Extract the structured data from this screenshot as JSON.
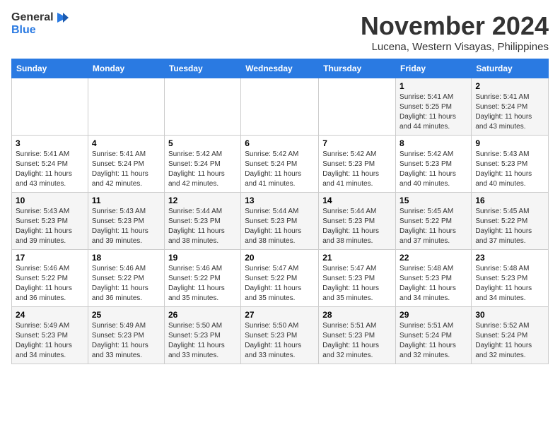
{
  "logo": {
    "line1": "General",
    "line2": "Blue"
  },
  "title": "November 2024",
  "location": "Lucena, Western Visayas, Philippines",
  "weekdays": [
    "Sunday",
    "Monday",
    "Tuesday",
    "Wednesday",
    "Thursday",
    "Friday",
    "Saturday"
  ],
  "weeks": [
    [
      {
        "day": "",
        "info": ""
      },
      {
        "day": "",
        "info": ""
      },
      {
        "day": "",
        "info": ""
      },
      {
        "day": "",
        "info": ""
      },
      {
        "day": "",
        "info": ""
      },
      {
        "day": "1",
        "info": "Sunrise: 5:41 AM\nSunset: 5:25 PM\nDaylight: 11 hours and 44 minutes."
      },
      {
        "day": "2",
        "info": "Sunrise: 5:41 AM\nSunset: 5:24 PM\nDaylight: 11 hours and 43 minutes."
      }
    ],
    [
      {
        "day": "3",
        "info": "Sunrise: 5:41 AM\nSunset: 5:24 PM\nDaylight: 11 hours and 43 minutes."
      },
      {
        "day": "4",
        "info": "Sunrise: 5:41 AM\nSunset: 5:24 PM\nDaylight: 11 hours and 42 minutes."
      },
      {
        "day": "5",
        "info": "Sunrise: 5:42 AM\nSunset: 5:24 PM\nDaylight: 11 hours and 42 minutes."
      },
      {
        "day": "6",
        "info": "Sunrise: 5:42 AM\nSunset: 5:24 PM\nDaylight: 11 hours and 41 minutes."
      },
      {
        "day": "7",
        "info": "Sunrise: 5:42 AM\nSunset: 5:23 PM\nDaylight: 11 hours and 41 minutes."
      },
      {
        "day": "8",
        "info": "Sunrise: 5:42 AM\nSunset: 5:23 PM\nDaylight: 11 hours and 40 minutes."
      },
      {
        "day": "9",
        "info": "Sunrise: 5:43 AM\nSunset: 5:23 PM\nDaylight: 11 hours and 40 minutes."
      }
    ],
    [
      {
        "day": "10",
        "info": "Sunrise: 5:43 AM\nSunset: 5:23 PM\nDaylight: 11 hours and 39 minutes."
      },
      {
        "day": "11",
        "info": "Sunrise: 5:43 AM\nSunset: 5:23 PM\nDaylight: 11 hours and 39 minutes."
      },
      {
        "day": "12",
        "info": "Sunrise: 5:44 AM\nSunset: 5:23 PM\nDaylight: 11 hours and 38 minutes."
      },
      {
        "day": "13",
        "info": "Sunrise: 5:44 AM\nSunset: 5:23 PM\nDaylight: 11 hours and 38 minutes."
      },
      {
        "day": "14",
        "info": "Sunrise: 5:44 AM\nSunset: 5:23 PM\nDaylight: 11 hours and 38 minutes."
      },
      {
        "day": "15",
        "info": "Sunrise: 5:45 AM\nSunset: 5:22 PM\nDaylight: 11 hours and 37 minutes."
      },
      {
        "day": "16",
        "info": "Sunrise: 5:45 AM\nSunset: 5:22 PM\nDaylight: 11 hours and 37 minutes."
      }
    ],
    [
      {
        "day": "17",
        "info": "Sunrise: 5:46 AM\nSunset: 5:22 PM\nDaylight: 11 hours and 36 minutes."
      },
      {
        "day": "18",
        "info": "Sunrise: 5:46 AM\nSunset: 5:22 PM\nDaylight: 11 hours and 36 minutes."
      },
      {
        "day": "19",
        "info": "Sunrise: 5:46 AM\nSunset: 5:22 PM\nDaylight: 11 hours and 35 minutes."
      },
      {
        "day": "20",
        "info": "Sunrise: 5:47 AM\nSunset: 5:22 PM\nDaylight: 11 hours and 35 minutes."
      },
      {
        "day": "21",
        "info": "Sunrise: 5:47 AM\nSunset: 5:23 PM\nDaylight: 11 hours and 35 minutes."
      },
      {
        "day": "22",
        "info": "Sunrise: 5:48 AM\nSunset: 5:23 PM\nDaylight: 11 hours and 34 minutes."
      },
      {
        "day": "23",
        "info": "Sunrise: 5:48 AM\nSunset: 5:23 PM\nDaylight: 11 hours and 34 minutes."
      }
    ],
    [
      {
        "day": "24",
        "info": "Sunrise: 5:49 AM\nSunset: 5:23 PM\nDaylight: 11 hours and 34 minutes."
      },
      {
        "day": "25",
        "info": "Sunrise: 5:49 AM\nSunset: 5:23 PM\nDaylight: 11 hours and 33 minutes."
      },
      {
        "day": "26",
        "info": "Sunrise: 5:50 AM\nSunset: 5:23 PM\nDaylight: 11 hours and 33 minutes."
      },
      {
        "day": "27",
        "info": "Sunrise: 5:50 AM\nSunset: 5:23 PM\nDaylight: 11 hours and 33 minutes."
      },
      {
        "day": "28",
        "info": "Sunrise: 5:51 AM\nSunset: 5:23 PM\nDaylight: 11 hours and 32 minutes."
      },
      {
        "day": "29",
        "info": "Sunrise: 5:51 AM\nSunset: 5:24 PM\nDaylight: 11 hours and 32 minutes."
      },
      {
        "day": "30",
        "info": "Sunrise: 5:52 AM\nSunset: 5:24 PM\nDaylight: 11 hours and 32 minutes."
      }
    ]
  ]
}
